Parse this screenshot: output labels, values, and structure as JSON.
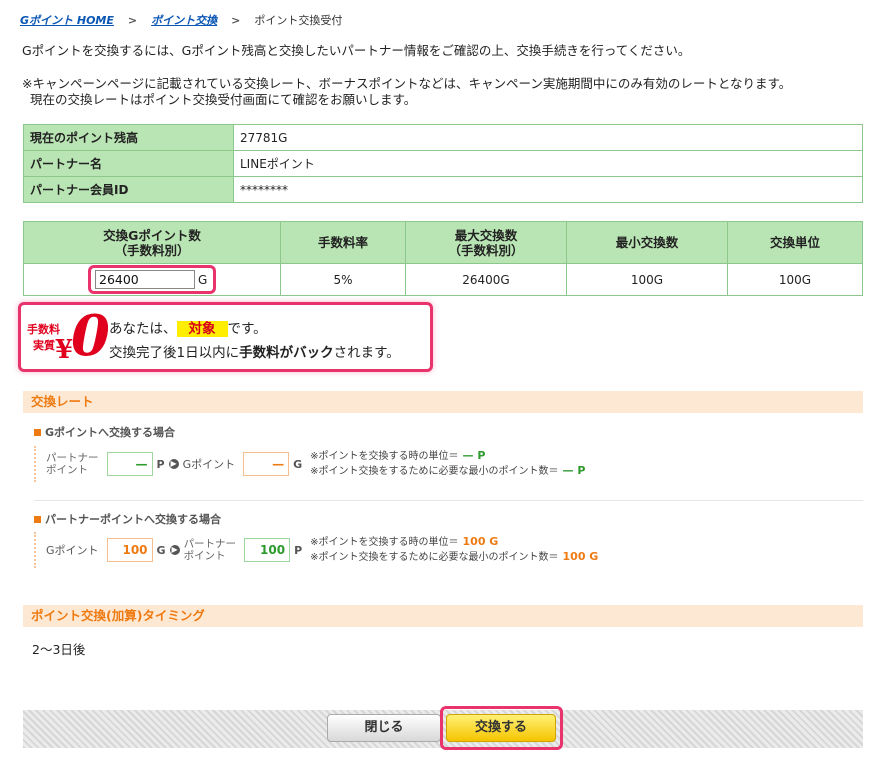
{
  "breadcrumb": {
    "home": "Gポイント HOME",
    "exchange": "ポイント交換",
    "current": "ポイント交換受付"
  },
  "intro": "Gポイントを交換するには、Gポイント残高と交換したいパートナー情報をご確認の上、交換手続きを行ってください。",
  "notice": {
    "line1": "※キャンペーンページに記載されている交換レート、ボーナスポイントなどは、キャンペーン実施期間中にのみ有効のレートとなります。",
    "line2": "現在の交換レートはポイント交換受付画面にて確認をお願いします。"
  },
  "info": {
    "balance_label": "現在のポイント残高",
    "balance_value": "27781G",
    "partner_label": "パートナー名",
    "partner_value": "LINEポイント",
    "member_label": "パートナー会員ID",
    "member_value": "********"
  },
  "exchange_table": {
    "headers": {
      "amount_1": "交換Gポイント数",
      "amount_2": "（手数料別）",
      "fee_rate": "手数料率",
      "max_1": "最大交換数",
      "max_2": "（手数料別）",
      "min": "最小交換数",
      "unit": "交換単位"
    },
    "amount_value": "26400",
    "amount_unit": "G",
    "fee_rate": "5%",
    "max": "26400G",
    "min": "100G",
    "unit": "100G"
  },
  "campaign": {
    "badge_l1": "手数料",
    "badge_l2": "実質",
    "badge_yen": "¥",
    "badge_zero": "0",
    "line1_pre": "あなたは、",
    "line1_hl": "対象",
    "line1_post": "です。",
    "line2_pre": "交換完了後1日以内に",
    "line2_bold": "手数料がバック",
    "line2_post": "されます。"
  },
  "rate": {
    "title": "交換レート",
    "to_g": {
      "heading": "Gポイントへ交換する場合",
      "from_1": "パートナー",
      "from_2": "ポイント",
      "from_value": "—",
      "from_unit": "P",
      "to_label": "Gポイント",
      "to_value": "—",
      "to_unit": "G",
      "note1": "※ポイントを交換する時の単位＝",
      "note1_val": "— P",
      "note2": "※ポイント交換をするために必要な最小のポイント数＝",
      "note2_val": "— P"
    },
    "to_partner": {
      "heading": "パートナーポイントへ交換する場合",
      "from_label": "Gポイント",
      "from_value": "100",
      "from_unit": "G",
      "to_1": "パートナー",
      "to_2": "ポイント",
      "to_value": "100",
      "to_unit": "P",
      "note1": "※ポイントを交換する時の単位＝",
      "note1_val": "100 G",
      "note2": "※ポイント交換をするために必要な最小のポイント数＝",
      "note2_val": "100 G"
    }
  },
  "timing": {
    "title": "ポイント交換(加算)タイミング",
    "value": "2〜3日後"
  },
  "buttons": {
    "close": "閉じる",
    "exchange": "交換する"
  },
  "colors": {
    "accent_pink": "#e8336d",
    "table_green": "#b9e4b3",
    "section_orange": "#ee7a12",
    "button_yellow": "#f5c400"
  }
}
